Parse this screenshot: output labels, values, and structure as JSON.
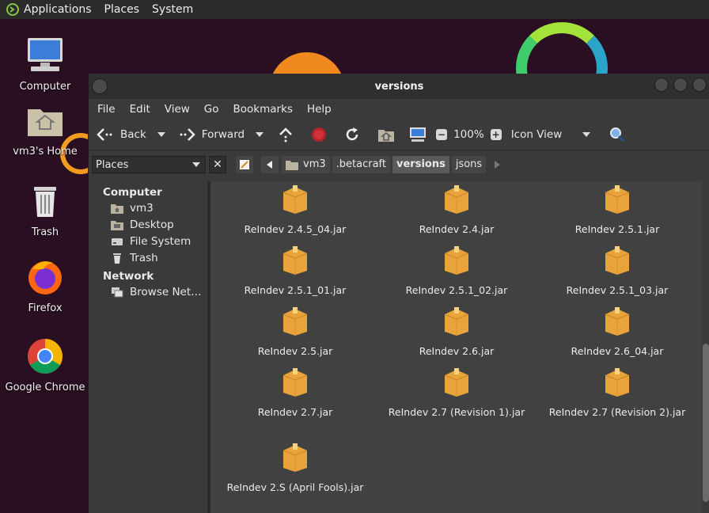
{
  "top_panel": {
    "menus": [
      "Applications",
      "Places",
      "System"
    ]
  },
  "desktop": {
    "icons": [
      {
        "label": "Computer",
        "icon": "computer-icon"
      },
      {
        "label": "vm3's Home",
        "icon": "home-folder-icon"
      },
      {
        "label": "Trash",
        "icon": "trash-icon"
      },
      {
        "label": "Firefox",
        "icon": "firefox-icon"
      },
      {
        "label": "Google Chrome",
        "icon": "chrome-icon"
      }
    ]
  },
  "window": {
    "title": "versions",
    "menubar": [
      "File",
      "Edit",
      "View",
      "Go",
      "Bookmarks",
      "Help"
    ],
    "toolbar": {
      "back_label": "Back",
      "forward_label": "Forward",
      "zoom_level": "100%",
      "view_mode": "Icon View"
    },
    "sidebar_header": "Places",
    "breadcrumbs": [
      "vm3",
      ".betacraft",
      "versions",
      "jsons"
    ],
    "active_breadcrumb": "versions",
    "sidebar": {
      "computer_label": "Computer",
      "computer_items": [
        {
          "label": "vm3",
          "icon": "home-folder-icon"
        },
        {
          "label": "Desktop",
          "icon": "desktop-folder-icon"
        },
        {
          "label": "File System",
          "icon": "drive-icon"
        },
        {
          "label": "Trash",
          "icon": "trash-icon"
        }
      ],
      "network_label": "Network",
      "network_items": [
        {
          "label": "Browse Net…",
          "icon": "network-icon"
        }
      ]
    },
    "files": [
      {
        "name": "ReIndev 2.4.5_04.jar"
      },
      {
        "name": "ReIndev 2.4.jar"
      },
      {
        "name": "ReIndev 2.5.1.jar"
      },
      {
        "name": "ReIndev 2.5.1_01.jar"
      },
      {
        "name": "ReIndev 2.5.1_02.jar"
      },
      {
        "name": "ReIndev 2.5.1_03.jar"
      },
      {
        "name": "ReIndev 2.5.jar"
      },
      {
        "name": "ReIndev 2.6.jar"
      },
      {
        "name": "ReIndev 2.6_04.jar"
      },
      {
        "name": "ReIndev 2.7.jar"
      },
      {
        "name": "ReIndev 2.7 (Revision 1).jar"
      },
      {
        "name": "ReIndev 2.7 (Revision 2).jar"
      },
      {
        "name": "ReIndev 2.S (April Fools).jar"
      }
    ]
  }
}
